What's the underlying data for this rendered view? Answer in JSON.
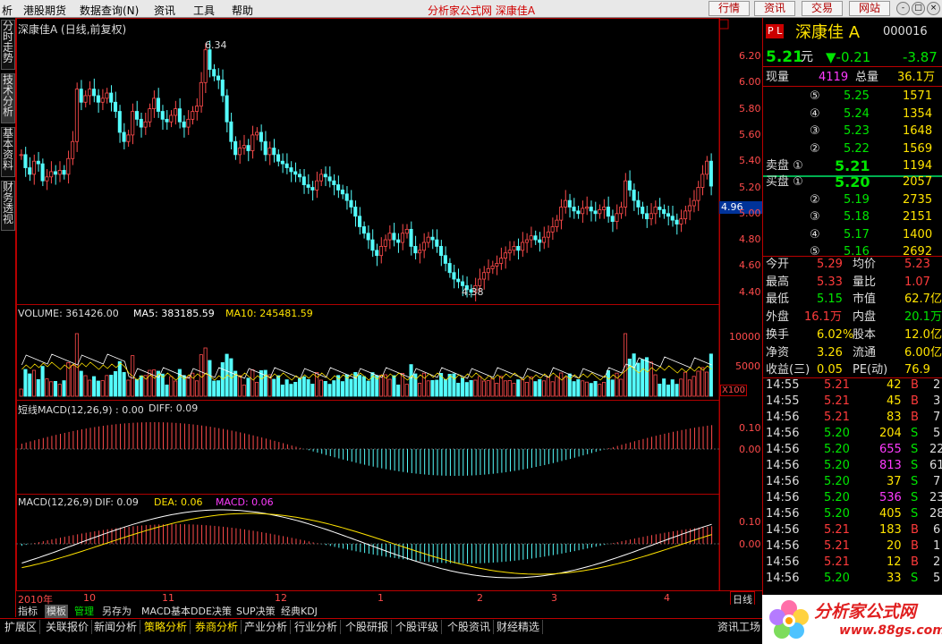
{
  "menu": {
    "items": [
      "析",
      "港股期货",
      "数据查询(N)",
      "资讯",
      "工具",
      "帮助"
    ],
    "title": "分析家公式网  深康佳A",
    "right_buttons": [
      "行情",
      "资讯",
      "交易",
      "网站"
    ],
    "win_buttons": [
      "-",
      "□",
      "×"
    ]
  },
  "left_tabs": [
    "分时走势",
    "技术分析",
    "基本资料",
    "财务透视"
  ],
  "kline": {
    "title": "深康佳A (日线,前复权)",
    "high_label": "6.34",
    "low_label": "4.38",
    "price_tag": "4.96",
    "yaxis": [
      "6.20",
      "6.00",
      "5.80",
      "5.60",
      "5.40",
      "5.20",
      "5.00",
      "4.80",
      "4.60",
      "4.40"
    ]
  },
  "volume": {
    "label": "VOLUME: 361426.00",
    "ma5": "MA5: 383185.59",
    "ma10": "MA10: 245481.59",
    "yaxis": [
      "10000",
      "5000"
    ],
    "unit": "X100"
  },
  "macd_short": {
    "label": "短线MACD(12,26,9)  : 0.00",
    "diff": "DIFF: 0.09",
    "yaxis": [
      "0.10",
      "0.00"
    ]
  },
  "macd": {
    "label": "MACD(12,26,9)",
    "dif": "DIF: 0.09",
    "dea": "DEA: 0.06",
    "macd": "MACD: 0.06",
    "yaxis": [
      "0.10",
      "0.00"
    ]
  },
  "xaxis": {
    "labels": [
      "2010年",
      "10",
      "11",
      "12",
      "1",
      "2",
      "3",
      "4"
    ],
    "period": "日线"
  },
  "quote": {
    "pl": "P L",
    "name": "深康佳 A",
    "code": "000016",
    "price": "5.21",
    "unit": "元",
    "change": "▼-0.21",
    "pct": "-3.87",
    "now_label": "现量",
    "now_val": "4119",
    "total_label": "总量",
    "total_val": "36.1万",
    "asks": [
      [
        "⑤",
        "5.25",
        "1571"
      ],
      [
        "④",
        "5.24",
        "1354"
      ],
      [
        "③",
        "5.23",
        "1648"
      ],
      [
        "②",
        "5.22",
        "1569"
      ],
      [
        "卖盘 ①",
        "5.21",
        "1194"
      ]
    ],
    "bids": [
      [
        "买盘 ①",
        "5.20",
        "2057"
      ],
      [
        "②",
        "5.19",
        "2735"
      ],
      [
        "③",
        "5.18",
        "2151"
      ],
      [
        "④",
        "5.17",
        "1400"
      ],
      [
        "⑤",
        "5.16",
        "2692"
      ]
    ],
    "stats": [
      [
        "今开",
        "5.29",
        "均价",
        "5.23"
      ],
      [
        "最高",
        "5.33",
        "量比",
        "1.07"
      ],
      [
        "最低",
        "5.15",
        "市值",
        "62.7亿"
      ],
      [
        "外盘",
        "16.1万",
        "内盘",
        "20.1万"
      ],
      [
        "换手",
        "6.02%",
        "股本",
        "12.0亿"
      ],
      [
        "净资",
        "3.26",
        "流通",
        "6.00亿"
      ],
      [
        "收益(三)",
        "0.05",
        "PE(动)",
        "76.9"
      ]
    ],
    "ticks": [
      [
        "14:55",
        "5.21",
        "42",
        "B",
        "2"
      ],
      [
        "14:55",
        "5.21",
        "45",
        "B",
        "3"
      ],
      [
        "14:56",
        "5.21",
        "83",
        "B",
        "7"
      ],
      [
        "14:56",
        "5.20",
        "204",
        "S",
        "5"
      ],
      [
        "14:56",
        "5.20",
        "655",
        "S",
        "22"
      ],
      [
        "14:56",
        "5.20",
        "813",
        "S",
        "61"
      ],
      [
        "14:56",
        "5.20",
        "37",
        "S",
        "7"
      ],
      [
        "14:56",
        "5.20",
        "536",
        "S",
        "23"
      ],
      [
        "14:56",
        "5.20",
        "405",
        "S",
        "28"
      ],
      [
        "14:56",
        "5.21",
        "183",
        "B",
        "6"
      ],
      [
        "14:56",
        "5.21",
        "20",
        "B",
        "1"
      ],
      [
        "14:56",
        "5.21",
        "12",
        "B",
        "2"
      ],
      [
        "14:56",
        "5.20",
        "33",
        "S",
        "5"
      ]
    ]
  },
  "tabs": [
    "指标",
    "模板",
    "管理",
    "另存为",
    "MACD基本",
    "DDE决策",
    "SUP决策",
    "经典KDJ"
  ],
  "bottom": [
    "扩展区",
    "关联报价",
    "新闻分析",
    "策略分析",
    "券商分析",
    "产业分析",
    "行业分析",
    "个股研报",
    "个股评级",
    "个股资讯",
    "财经精选",
    "资讯工场"
  ],
  "logo": {
    "text": "分析家公式网",
    "url": "www.88gs.com"
  }
}
